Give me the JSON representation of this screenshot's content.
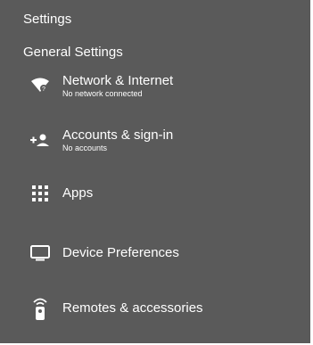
{
  "header": {
    "title": "Settings"
  },
  "section": {
    "title": "General Settings"
  },
  "items": [
    {
      "label": "Network & Internet",
      "sub": "No network connected",
      "icon": "wifi-unknown-icon"
    },
    {
      "label": "Accounts & sign-in",
      "sub": "No accounts",
      "icon": "add-account-icon"
    },
    {
      "label": "Apps",
      "sub": "",
      "icon": "apps-grid-icon"
    },
    {
      "label": "Device Preferences",
      "sub": "",
      "icon": "monitor-icon"
    },
    {
      "label": "Remotes & accessories",
      "sub": "",
      "icon": "remote-icon"
    }
  ],
  "colors": {
    "background": "#5a5a5a",
    "text": "#ffffff"
  }
}
